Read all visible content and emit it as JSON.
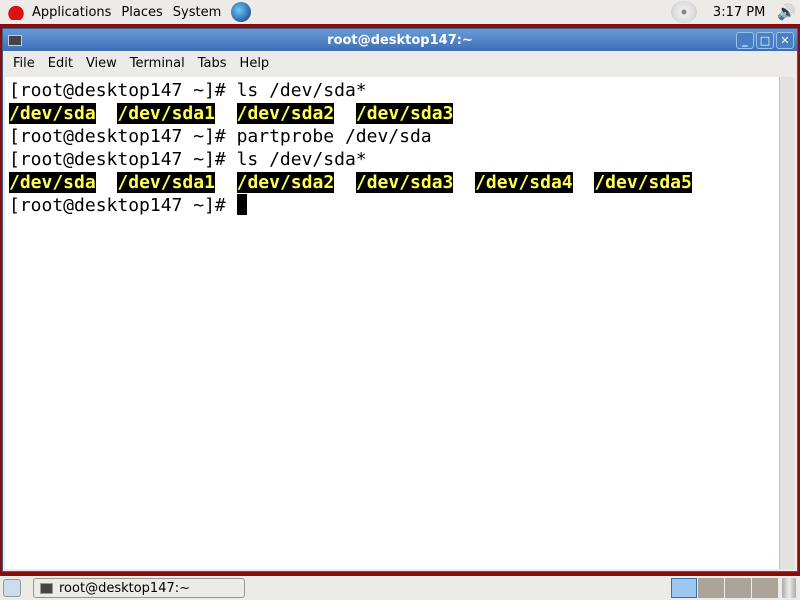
{
  "top_panel": {
    "menus": [
      "Applications",
      "Places",
      "System"
    ],
    "clock": "3:17 PM"
  },
  "window": {
    "title": "root@desktop147:~",
    "menu": [
      "File",
      "Edit",
      "View",
      "Terminal",
      "Tabs",
      "Help"
    ]
  },
  "terminal": {
    "prompt": "[root@desktop147 ~]# ",
    "lines": [
      {
        "cmd": "ls /dev/sda*"
      },
      {
        "out": [
          "/dev/sda",
          "/dev/sda1",
          "/dev/sda2",
          "/dev/sda3"
        ]
      },
      {
        "cmd": "partprobe /dev/sda"
      },
      {
        "cmd": "ls /dev/sda*"
      },
      {
        "out": [
          "/dev/sda",
          "/dev/sda1",
          "/dev/sda2",
          "/dev/sda3",
          "/dev/sda4",
          "/dev/sda5"
        ]
      },
      {
        "cmd": ""
      }
    ],
    "highlight_color": "#ffff55"
  },
  "taskbar": {
    "task": "root@desktop147:~",
    "workspaces": 4,
    "active_workspace": 1
  }
}
